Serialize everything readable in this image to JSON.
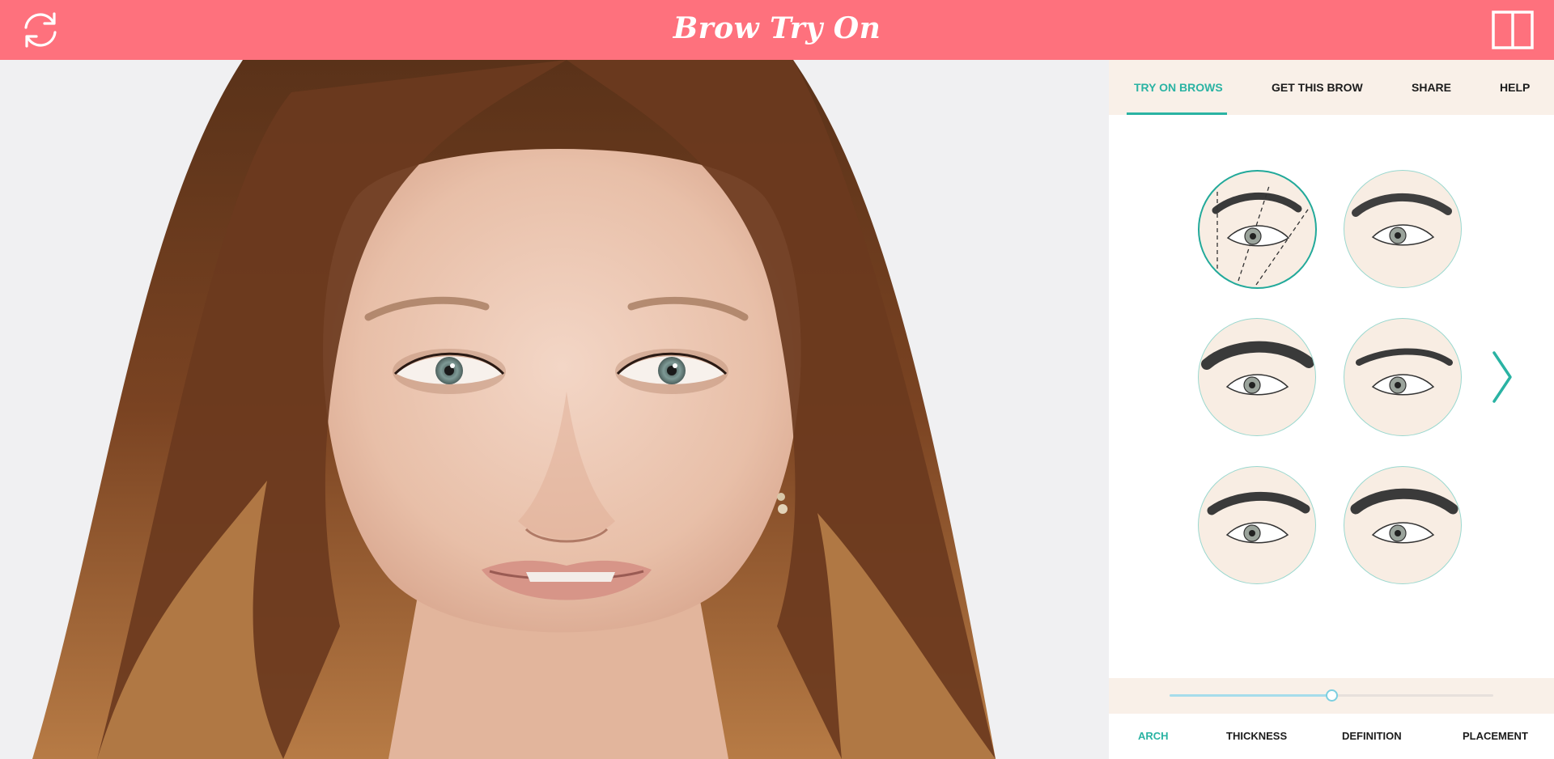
{
  "header": {
    "title": "Brow Try On",
    "background_color": "#fe717d",
    "refresh_icon": "refresh-icon",
    "compare_icon": "split-view-icon"
  },
  "photo": {
    "subject": "portrait"
  },
  "tabs": [
    {
      "label": "TRY ON BROWS",
      "active": true
    },
    {
      "label": "GET THIS BROW",
      "active": false
    },
    {
      "label": "SHARE",
      "active": false
    },
    {
      "label": "HELP",
      "active": false
    }
  ],
  "accent_color": "#2ab3a3",
  "brow_styles": [
    {
      "selected": true
    },
    {
      "selected": false
    },
    {
      "selected": false
    },
    {
      "selected": false
    },
    {
      "selected": false
    },
    {
      "selected": false
    }
  ],
  "next_icon": "chevron-right-icon",
  "slider": {
    "value_fraction": 0.5
  },
  "adjust_tabs": [
    {
      "label": "ARCH",
      "active": true
    },
    {
      "label": "THICKNESS",
      "active": false
    },
    {
      "label": "DEFINITION",
      "active": false
    },
    {
      "label": "PLACEMENT",
      "active": false
    }
  ]
}
